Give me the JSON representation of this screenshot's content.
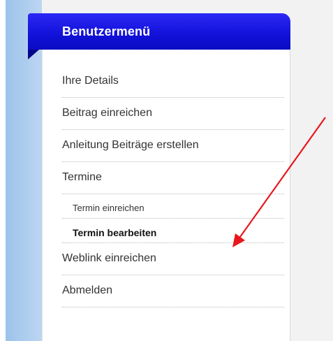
{
  "menu": {
    "title": "Benutzermenü",
    "items": [
      {
        "label": "Ihre Details"
      },
      {
        "label": "Beitrag einreichen"
      },
      {
        "label": "Anleitung Beiträge erstellen"
      },
      {
        "label": "Termine"
      },
      {
        "label": "Termin einreichen"
      },
      {
        "label": "Termin bearbeiten"
      },
      {
        "label": "Weblink einreichen"
      },
      {
        "label": "Abmelden"
      }
    ]
  },
  "colors": {
    "header": "#1a1ae6",
    "arrow": "#e8171c",
    "sidebar": "#a9cbee",
    "text": "#333333"
  }
}
